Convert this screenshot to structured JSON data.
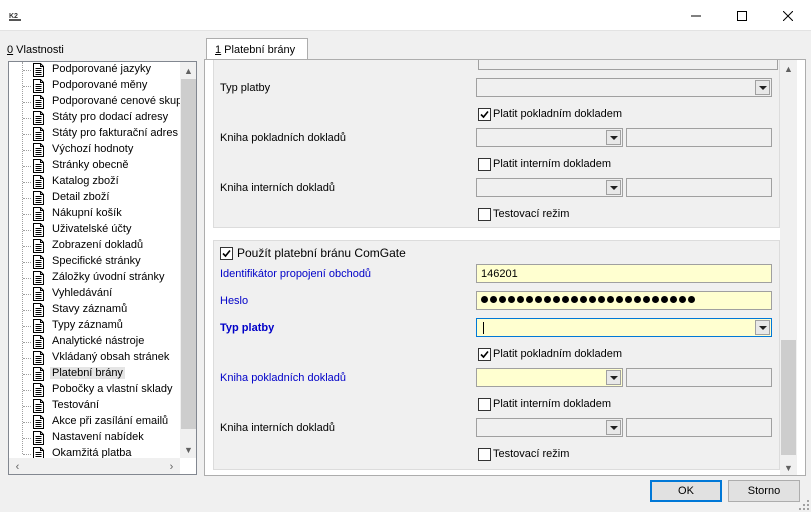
{
  "window": {
    "app_icon": "k2-app-icon",
    "minimize": "minimize-icon",
    "maximize": "maximize-icon",
    "close": "close-icon"
  },
  "left": {
    "title_prefix": "0",
    "title_rest": " Vlastnosti",
    "items": [
      {
        "label": "Podporované jazyky"
      },
      {
        "label": "Podporované měny"
      },
      {
        "label": "Podporované cenové skup"
      },
      {
        "label": "Státy pro dodací adresy"
      },
      {
        "label": "Státy pro fakturační adres"
      },
      {
        "label": "Výchozí hodnoty"
      },
      {
        "label": "Stránky obecně"
      },
      {
        "label": "Katalog zboží"
      },
      {
        "label": "Detail zboží"
      },
      {
        "label": "Nákupní košík"
      },
      {
        "label": "Uživatelské účty"
      },
      {
        "label": "Zobrazení dokladů"
      },
      {
        "label": "Specifické stránky"
      },
      {
        "label": "Záložky úvodní stránky"
      },
      {
        "label": "Vyhledávání"
      },
      {
        "label": "Stavy záznamů"
      },
      {
        "label": "Typy záznamů"
      },
      {
        "label": "Analytické nástroje"
      },
      {
        "label": "Vkládaný obsah stránek"
      },
      {
        "label": "Platební brány"
      },
      {
        "label": "Pobočky a vlastní sklady"
      },
      {
        "label": "Testování"
      },
      {
        "label": "Akce při zasílání emailů"
      },
      {
        "label": "Nastavení nabídek"
      },
      {
        "label": "Okamžitá platba"
      }
    ],
    "selected_index": 19
  },
  "tab": {
    "label_prefix": "1",
    "label_rest": " Platební brány"
  },
  "section1": {
    "typ_platby_label": "Typ platby",
    "typ_platby_value": "",
    "platit_pokladnim_label": "Platit pokladním dokladem",
    "platit_pokladnim_checked": true,
    "kniha_pokladnich_label": "Kniha pokladních dokladů",
    "kniha_pokladnich_value": "",
    "kniha_pokladnich_text": "",
    "platit_internim_label": "Platit interním dokladem",
    "platit_internim_checked": false,
    "kniha_internich_label": "Kniha interních dokladů",
    "kniha_internich_value": "",
    "kniha_internich_text": "",
    "testovaci_label": "Testovací režim",
    "testovaci_checked": false
  },
  "section2": {
    "use_label": "Použít platební bránu ComGate",
    "use_checked": true,
    "identifikator_label": "Identifikátor propojení obchodů",
    "identifikator_value": "146201",
    "heslo_label": "Heslo",
    "heslo_dots": 24,
    "typ_platby_label": "Typ platby",
    "typ_platby_value": "",
    "platit_pokladnim_label": "Platit pokladním dokladem",
    "platit_pokladnim_checked": true,
    "kniha_pokladnich_label": "Kniha pokladních dokladů",
    "kniha_pokladnich_value": "",
    "kniha_pokladnich_text": "",
    "platit_internim_label": "Platit interním dokladem",
    "platit_internim_checked": false,
    "kniha_internich_label": "Kniha interních dokladů",
    "kniha_internich_value": "",
    "kniha_internich_text": "",
    "testovaci_label": "Testovací režim",
    "testovaci_checked": false
  },
  "buttons": {
    "ok": "OK",
    "cancel": "Storno"
  },
  "colors": {
    "required_label": "#0000c8",
    "required_field": "#ffffd0",
    "focus_border": "#0078d7"
  }
}
